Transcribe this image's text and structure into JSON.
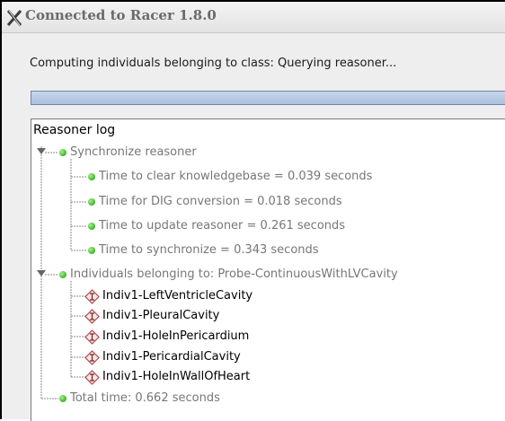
{
  "window": {
    "title": "Connected to Racer 1.8.0"
  },
  "status": {
    "message": "Computing individuals belonging to class: Querying reasoner..."
  },
  "log": {
    "heading": "Reasoner log",
    "sync": {
      "label": "Synchronize reasoner",
      "items": [
        "Time to clear knowledgebase = 0.039 seconds",
        "Time for DIG conversion = 0.018 seconds",
        "Time to update reasoner = 0.261 seconds",
        "Time to synchronize = 0.343 seconds"
      ]
    },
    "individuals": {
      "label": "Individuals belonging to: Probe-ContinuousWithLVCavity",
      "items": [
        "Indiv1-LeftVentricleCavity",
        "Indiv1-PleuralCavity",
        "Indiv1-HoleInPericardium",
        "Indiv1-PericardialCavity",
        "Indiv1-HoleInWallOfHeart"
      ]
    },
    "total": "Total time: 0.662 seconds"
  },
  "icons": {
    "app": "x-window-icon",
    "node": "green-dot-icon",
    "individual": "individual-diamond-icon",
    "expanded": "expanded-triangle-icon"
  },
  "colors": {
    "tree_line": "#8a8a8a",
    "muted_text": "#777777",
    "progress": "#bfd0e6"
  }
}
